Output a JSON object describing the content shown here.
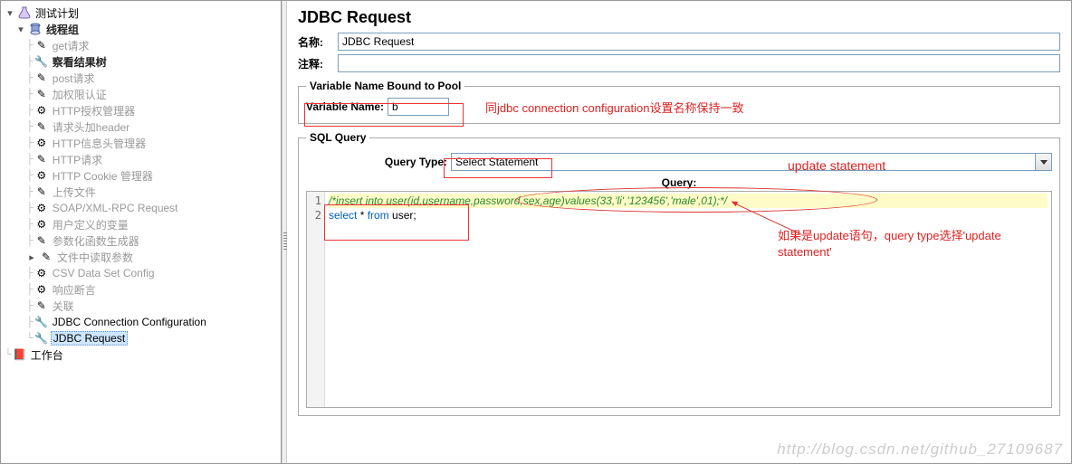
{
  "tree": {
    "root": "测试计划",
    "thread_group": "线程组",
    "items": [
      "get请求",
      "察看结果树",
      "post请求",
      "加权限认证",
      "HTTP授权管理器",
      "请求头加header",
      "HTTP信息头管理器",
      "HTTP请求",
      "HTTP Cookie 管理器",
      "上传文件",
      "SOAP/XML-RPC Request",
      "用户定义的变量",
      "参数化函数生成器",
      "文件中读取参数",
      "CSV Data Set Config",
      "响应断言",
      "关联",
      "JDBC Connection Configuration",
      "JDBC Request"
    ],
    "workbench": "工作台"
  },
  "panel": {
    "title": "JDBC Request",
    "name_label": "名称:",
    "name_value": "JDBC Request",
    "comment_label": "注释:",
    "comment_value": "",
    "var_legend": "Variable Name Bound to Pool",
    "var_label": "Variable Name:",
    "var_value": "b",
    "sql_legend": "SQL Query",
    "qt_label": "Query Type:",
    "qt_value": "Select Statement",
    "query_label": "Query:",
    "code_line1": "/*insert into user(id,username,password,sex,age)values(33,'li','123456','male',01);*/",
    "code_line2a": "select",
    "code_line2b": " * ",
    "code_line2c": "from",
    "code_line2d": " user;"
  },
  "annotations": {
    "a1": "同jdbc connection configuration设置名称保持一致",
    "a2": "update statement",
    "a3": "如果是update语句，query type选择'update statement'"
  },
  "watermark": "http://blog.csdn.net/github_27109687"
}
